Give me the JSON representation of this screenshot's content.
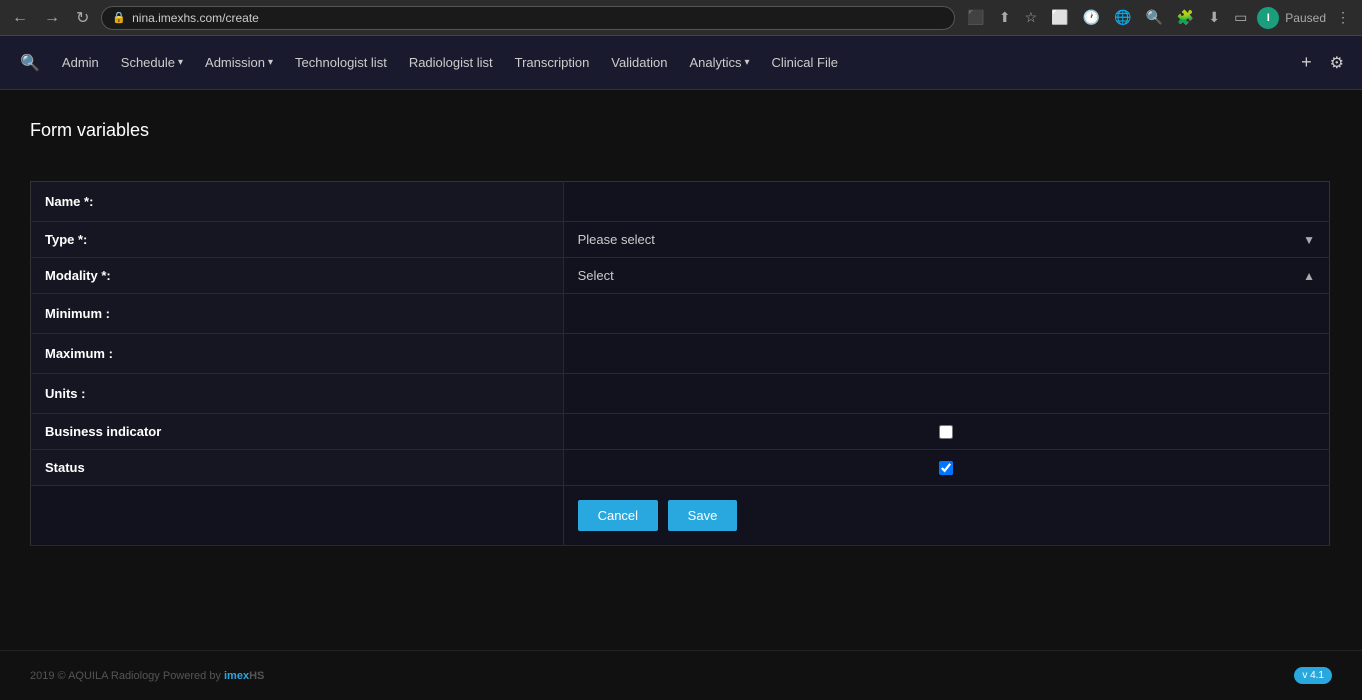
{
  "browser": {
    "url": "nina.imexhs.com/create",
    "paused_label": "Paused",
    "profile_initial": "I"
  },
  "navbar": {
    "search_icon": "🔍",
    "items": [
      {
        "label": "Admin",
        "has_dropdown": false
      },
      {
        "label": "Schedule",
        "has_dropdown": true
      },
      {
        "label": "Admission",
        "has_dropdown": true
      },
      {
        "label": "Technologist list",
        "has_dropdown": false
      },
      {
        "label": "Radiologist list",
        "has_dropdown": false
      },
      {
        "label": "Transcription",
        "has_dropdown": false
      },
      {
        "label": "Validation",
        "has_dropdown": false
      },
      {
        "label": "Analytics",
        "has_dropdown": true
      },
      {
        "label": "Clinical File",
        "has_dropdown": false
      }
    ],
    "plus_label": "+",
    "gear_label": "⚙"
  },
  "page": {
    "title": "Form variables"
  },
  "form": {
    "fields": [
      {
        "label": "Name *:",
        "type": "input",
        "value": "",
        "placeholder": ""
      },
      {
        "label": "Type *:",
        "type": "select",
        "value": "Please select",
        "arrow": "▼"
      },
      {
        "label": "Modality *:",
        "type": "select",
        "value": "Select",
        "arrow": "▲"
      },
      {
        "label": "Minimum :",
        "type": "input",
        "value": "",
        "placeholder": ""
      },
      {
        "label": "Maximum :",
        "type": "input",
        "value": "",
        "placeholder": ""
      },
      {
        "label": "Units :",
        "type": "input",
        "value": "",
        "placeholder": ""
      },
      {
        "label": "Business indicator",
        "type": "checkbox",
        "checked": false
      },
      {
        "label": "Status",
        "type": "checkbox",
        "checked": true
      }
    ],
    "cancel_label": "Cancel",
    "save_label": "Save"
  },
  "footer": {
    "copyright": "2019 © AQUILA Radiology Powered by ",
    "brand_imex": "imex",
    "brand_hs": "HS",
    "version": "v 4.1"
  }
}
